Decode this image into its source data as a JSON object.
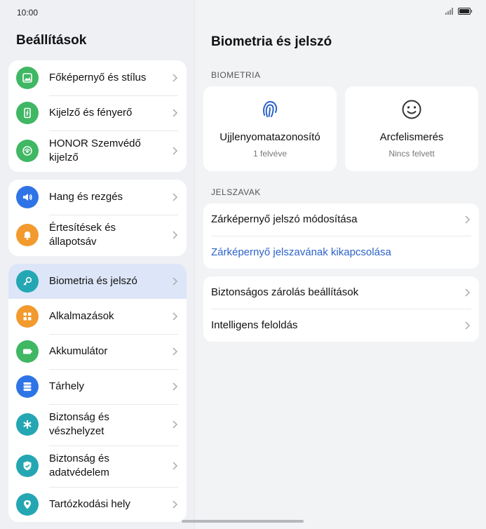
{
  "status_bar": {
    "time": "10:00"
  },
  "left_panel": {
    "title": "Beállítások",
    "groups": [
      [
        {
          "label": "Főképernyő és stílus",
          "icon": "image-icon",
          "color": "#3fb763"
        },
        {
          "label": "Kijelző és fényerő",
          "icon": "display-icon",
          "color": "#3fb763"
        },
        {
          "label": "HONOR Szemvédő kijelző",
          "icon": "eye-comfort-icon",
          "color": "#3fb763"
        }
      ],
      [
        {
          "label": "Hang és rezgés",
          "icon": "speaker-icon",
          "color": "#2f74e6"
        },
        {
          "label": "Értesítések és állapotsáv",
          "icon": "bell-icon",
          "color": "#f29a2e"
        }
      ],
      [
        {
          "label": "Biometria és jelszó",
          "icon": "key-icon",
          "color": "#24a7b3",
          "active": true
        },
        {
          "label": "Alkalmazások",
          "icon": "apps-icon",
          "color": "#f29a2e"
        },
        {
          "label": "Akkumulátor",
          "icon": "battery-icon",
          "color": "#3fb763"
        },
        {
          "label": "Tárhely",
          "icon": "storage-icon",
          "color": "#2f74e6"
        },
        {
          "label": "Biztonság és vészhelyzet",
          "icon": "asterisk-icon",
          "color": "#24a7b3"
        },
        {
          "label": "Biztonság és adatvédelem",
          "icon": "shield-icon",
          "color": "#24a7b3"
        },
        {
          "label": "Tartózkodási hely",
          "icon": "location-icon",
          "color": "#24a7b3"
        }
      ]
    ]
  },
  "right_panel": {
    "title": "Biometria és jelszó",
    "biometrics_label": "BIOMETRIA",
    "fingerprint": {
      "title": "Ujjlenyomatazonosító",
      "subtitle": "1 felvéve"
    },
    "face": {
      "title": "Arcfelismerés",
      "subtitle": "Nincs felvett"
    },
    "passwords_label": "JELSZAVAK",
    "change_password": "Zárképernyő jelszó módosítása",
    "disable_password": "Zárképernyő jelszavának kikapcsolása",
    "secure_lock": "Biztonságos zárolás beállítások",
    "smart_unlock": "Intelligens feloldás"
  },
  "accent": "#2b63c8"
}
